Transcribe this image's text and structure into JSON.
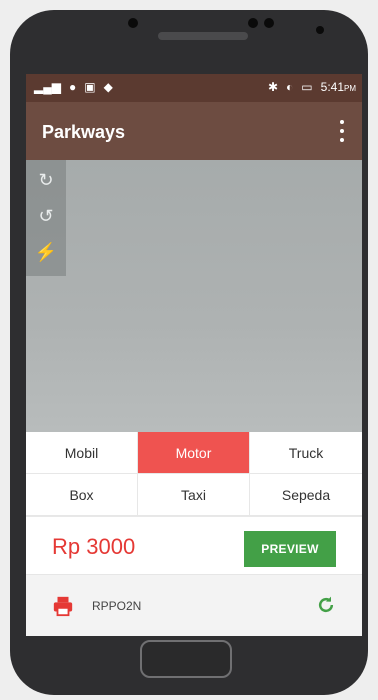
{
  "status": {
    "time": "5:41",
    "ampm": "PM",
    "left_icons": [
      "signal-icon",
      "person-icon",
      "image-icon",
      "shield-icon"
    ],
    "right_icons": [
      "bluetooth-icon",
      "volume-icon",
      "battery-icon"
    ]
  },
  "appbar": {
    "title": "Parkways"
  },
  "vehicles": [
    {
      "label": "Mobil",
      "active": false
    },
    {
      "label": "Motor",
      "active": true
    },
    {
      "label": "Truck",
      "active": false
    },
    {
      "label": "Box",
      "active": false
    },
    {
      "label": "Taxi",
      "active": false
    },
    {
      "label": "Sepeda",
      "active": false
    }
  ],
  "price": {
    "value": "Rp 3000"
  },
  "preview_label": "PREVIEW",
  "bottom": {
    "code": "RPPO2N"
  },
  "colors": {
    "appbar": "#6d4c41",
    "statusbar": "#5b3a30",
    "active_tab": "#ef5350",
    "preview_button": "#43a047",
    "price_text": "#e53935",
    "refresh_icon": "#43a047",
    "print_icon": "#e53935"
  }
}
